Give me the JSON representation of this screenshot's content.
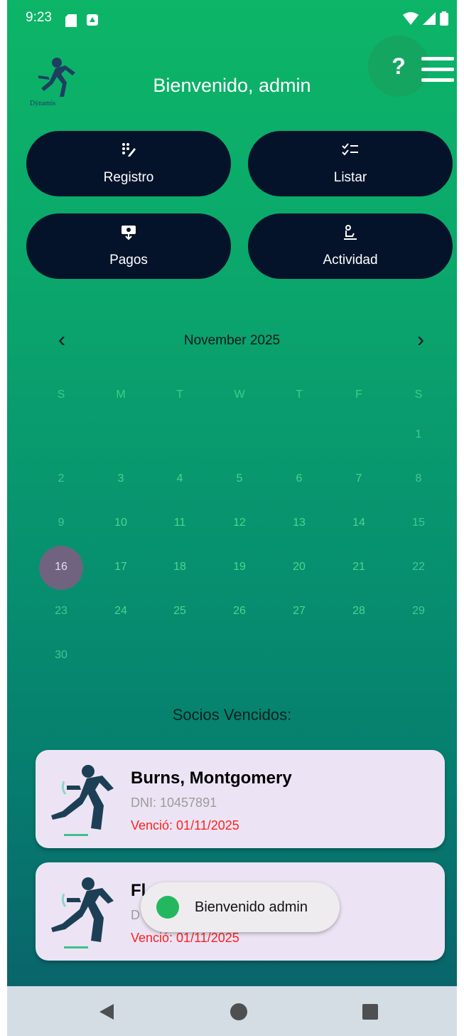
{
  "status_bar": {
    "time": "9:23"
  },
  "header": {
    "welcome": "Bienvenido, admin",
    "help_label": "?",
    "logo_text": "Dýnamis"
  },
  "actions": {
    "registro": "Registro",
    "listar": "Listar",
    "pagos": "Pagos",
    "actividad": "Actividad"
  },
  "calendar": {
    "month_label": "November 2025",
    "prev": "‹",
    "next": "›",
    "weekdays": [
      "S",
      "M",
      "T",
      "W",
      "T",
      "F",
      "S"
    ],
    "days": [
      "1",
      "2",
      "3",
      "4",
      "5",
      "6",
      "7",
      "8",
      "9",
      "10",
      "11",
      "12",
      "13",
      "14",
      "15",
      "16",
      "17",
      "18",
      "19",
      "20",
      "21",
      "22",
      "23",
      "24",
      "25",
      "26",
      "27",
      "28",
      "29",
      "30"
    ],
    "selected_day": "16"
  },
  "section_title": "Socios Vencidos:",
  "members": [
    {
      "name": "Burns, Montgomery",
      "dni": "DNI: 10457891",
      "expired": "Venció: 01/11/2025"
    },
    {
      "name": "Fl",
      "dni": "D",
      "expired": "Venció: 01/11/2025"
    }
  ],
  "toast": {
    "text": "Bienvenido admin"
  },
  "colors": {
    "brand_green": "#0cb567",
    "button_navy": "#04132a",
    "expired_red": "#ff1f1f",
    "card_bg": "#ece4f4"
  }
}
